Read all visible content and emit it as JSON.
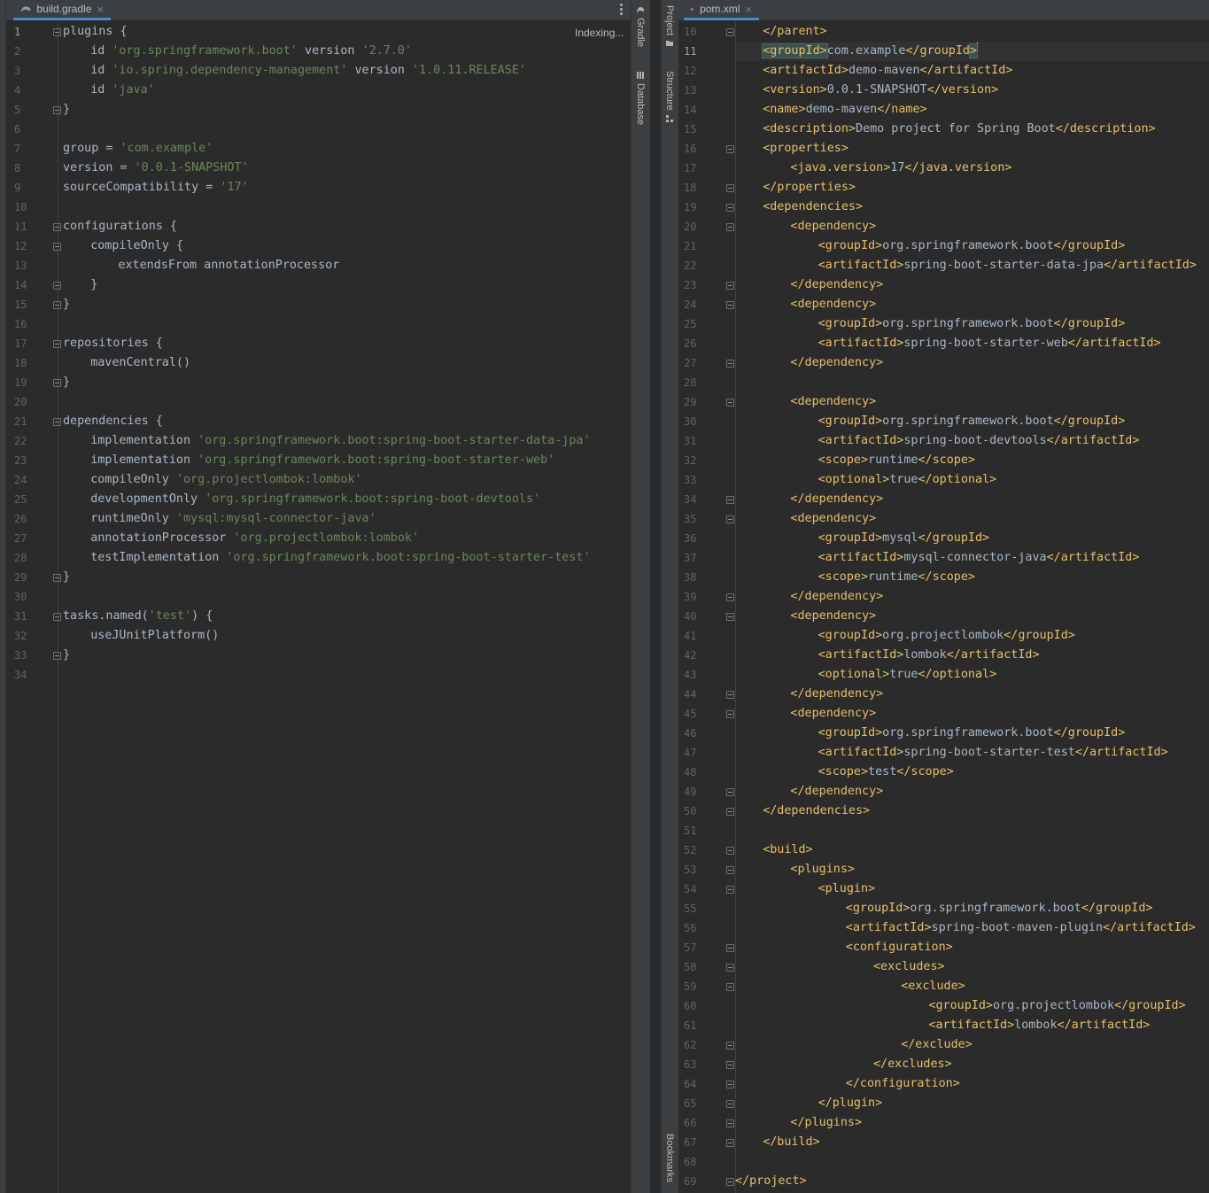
{
  "left_editor": {
    "tab": {
      "filename": "build.gradle",
      "icon": "gradle-elephant-icon"
    },
    "indexing_status": "Indexing...",
    "current_line": 1,
    "lines": [
      {
        "n": 1,
        "i": 0,
        "t": [
          {
            "k": "p",
            "v": "plugins {"
          }
        ],
        "fold": true
      },
      {
        "n": 2,
        "i": 1,
        "t": [
          {
            "k": "p",
            "v": "id "
          },
          {
            "k": "s",
            "v": "'org.springframework.boot'"
          },
          {
            "k": "p",
            "v": " version "
          },
          {
            "k": "s",
            "v": "'2.7.0'"
          }
        ]
      },
      {
        "n": 3,
        "i": 1,
        "t": [
          {
            "k": "p",
            "v": "id "
          },
          {
            "k": "s",
            "v": "'io.spring.dependency-management'"
          },
          {
            "k": "p",
            "v": " version "
          },
          {
            "k": "s",
            "v": "'1.0.11.RELEASE'"
          }
        ]
      },
      {
        "n": 4,
        "i": 1,
        "t": [
          {
            "k": "p",
            "v": "id "
          },
          {
            "k": "s",
            "v": "'java'"
          }
        ]
      },
      {
        "n": 5,
        "i": 0,
        "t": [
          {
            "k": "p",
            "v": "}"
          }
        ],
        "fold": true
      },
      {
        "n": 6,
        "i": 0,
        "t": []
      },
      {
        "n": 7,
        "i": 0,
        "t": [
          {
            "k": "p",
            "v": "group = "
          },
          {
            "k": "s",
            "v": "'com.example'"
          }
        ]
      },
      {
        "n": 8,
        "i": 0,
        "t": [
          {
            "k": "p",
            "v": "version = "
          },
          {
            "k": "s",
            "v": "'0.0.1-SNAPSHOT'"
          }
        ]
      },
      {
        "n": 9,
        "i": 0,
        "t": [
          {
            "k": "p",
            "v": "sourceCompatibility = "
          },
          {
            "k": "s",
            "v": "'17'"
          }
        ]
      },
      {
        "n": 10,
        "i": 0,
        "t": []
      },
      {
        "n": 11,
        "i": 0,
        "t": [
          {
            "k": "p",
            "v": "configurations {"
          }
        ],
        "fold": true
      },
      {
        "n": 12,
        "i": 1,
        "t": [
          {
            "k": "p",
            "v": "compileOnly {"
          }
        ],
        "fold": true
      },
      {
        "n": 13,
        "i": 2,
        "t": [
          {
            "k": "p",
            "v": "extendsFrom annotationProcessor"
          }
        ]
      },
      {
        "n": 14,
        "i": 1,
        "t": [
          {
            "k": "p",
            "v": "}"
          }
        ],
        "fold": true
      },
      {
        "n": 15,
        "i": 0,
        "t": [
          {
            "k": "p",
            "v": "}"
          }
        ],
        "fold": true
      },
      {
        "n": 16,
        "i": 0,
        "t": []
      },
      {
        "n": 17,
        "i": 0,
        "t": [
          {
            "k": "p",
            "v": "repositories {"
          }
        ],
        "fold": true
      },
      {
        "n": 18,
        "i": 1,
        "t": [
          {
            "k": "p",
            "v": "mavenCentral()"
          }
        ]
      },
      {
        "n": 19,
        "i": 0,
        "t": [
          {
            "k": "p",
            "v": "}"
          }
        ],
        "fold": true
      },
      {
        "n": 20,
        "i": 0,
        "t": []
      },
      {
        "n": 21,
        "i": 0,
        "t": [
          {
            "k": "p",
            "v": "dependencies {"
          }
        ],
        "fold": true
      },
      {
        "n": 22,
        "i": 1,
        "t": [
          {
            "k": "p",
            "v": "implementation "
          },
          {
            "k": "s",
            "v": "'org.springframework.boot:spring-boot-starter-data-jpa'"
          }
        ]
      },
      {
        "n": 23,
        "i": 1,
        "t": [
          {
            "k": "p",
            "v": "implementation "
          },
          {
            "k": "s",
            "v": "'org.springframework.boot:spring-boot-starter-web'"
          }
        ]
      },
      {
        "n": 24,
        "i": 1,
        "t": [
          {
            "k": "p",
            "v": "compileOnly "
          },
          {
            "k": "s",
            "v": "'org.projectlombok:lombok'"
          }
        ]
      },
      {
        "n": 25,
        "i": 1,
        "t": [
          {
            "k": "p",
            "v": "developmentOnly "
          },
          {
            "k": "s",
            "v": "'org.springframework.boot:spring-boot-devtools'"
          }
        ]
      },
      {
        "n": 26,
        "i": 1,
        "t": [
          {
            "k": "p",
            "v": "runtimeOnly "
          },
          {
            "k": "s",
            "v": "'mysql:mysql-connector-java'"
          }
        ]
      },
      {
        "n": 27,
        "i": 1,
        "t": [
          {
            "k": "p",
            "v": "annotationProcessor "
          },
          {
            "k": "s",
            "v": "'org.projectlombok:lombok'"
          }
        ]
      },
      {
        "n": 28,
        "i": 1,
        "t": [
          {
            "k": "p",
            "v": "testImplementation "
          },
          {
            "k": "s",
            "v": "'org.springframework.boot:spring-boot-starter-test'"
          }
        ]
      },
      {
        "n": 29,
        "i": 0,
        "t": [
          {
            "k": "p",
            "v": "}"
          }
        ],
        "fold": true
      },
      {
        "n": 30,
        "i": 0,
        "t": []
      },
      {
        "n": 31,
        "i": 0,
        "t": [
          {
            "k": "p",
            "v": "tasks.named("
          },
          {
            "k": "s",
            "v": "'test'"
          },
          {
            "k": "p",
            "v": ") {"
          }
        ],
        "fold": true
      },
      {
        "n": 32,
        "i": 1,
        "t": [
          {
            "k": "p",
            "v": "useJUnitPlatform()"
          }
        ]
      },
      {
        "n": 33,
        "i": 0,
        "t": [
          {
            "k": "p",
            "v": "}"
          }
        ],
        "fold": true
      },
      {
        "n": 34,
        "i": 0,
        "t": []
      }
    ]
  },
  "tool_windows": {
    "gradle": "Gradle",
    "database": "Database",
    "project": "Project",
    "structure": "Structure",
    "bookmarks": "Bookmarks"
  },
  "right_editor": {
    "tab": {
      "filename": "pom.xml",
      "icon": "maven-m-icon"
    },
    "current_line": 11,
    "lines": [
      {
        "n": 10,
        "i": 1,
        "t": "</parent>",
        "fold": true
      },
      {
        "n": 11,
        "i": 1,
        "t": "<groupId>com.example</groupId>",
        "caret": true
      },
      {
        "n": 12,
        "i": 1,
        "t": "<artifactId>demo-maven</artifactId>"
      },
      {
        "n": 13,
        "i": 1,
        "t": "<version>0.0.1-SNAPSHOT</version>"
      },
      {
        "n": 14,
        "i": 1,
        "t": "<name>demo-maven</name>"
      },
      {
        "n": 15,
        "i": 1,
        "t": "<description>Demo project for Spring Boot</description>"
      },
      {
        "n": 16,
        "i": 1,
        "t": "<properties>",
        "fold": true
      },
      {
        "n": 17,
        "i": 2,
        "t": "<java.version>17</java.version>"
      },
      {
        "n": 18,
        "i": 1,
        "t": "</properties>",
        "fold": true
      },
      {
        "n": 19,
        "i": 1,
        "t": "<dependencies>",
        "fold": true
      },
      {
        "n": 20,
        "i": 2,
        "t": "<dependency>",
        "fold": true
      },
      {
        "n": 21,
        "i": 3,
        "t": "<groupId>org.springframework.boot</groupId>"
      },
      {
        "n": 22,
        "i": 3,
        "t": "<artifactId>spring-boot-starter-data-jpa</artifactId>"
      },
      {
        "n": 23,
        "i": 2,
        "t": "</dependency>",
        "fold": true
      },
      {
        "n": 24,
        "i": 2,
        "t": "<dependency>",
        "fold": true
      },
      {
        "n": 25,
        "i": 3,
        "t": "<groupId>org.springframework.boot</groupId>"
      },
      {
        "n": 26,
        "i": 3,
        "t": "<artifactId>spring-boot-starter-web</artifactId>"
      },
      {
        "n": 27,
        "i": 2,
        "t": "</dependency>",
        "fold": true
      },
      {
        "n": 28,
        "i": 0,
        "t": ""
      },
      {
        "n": 29,
        "i": 2,
        "t": "<dependency>",
        "fold": true
      },
      {
        "n": 30,
        "i": 3,
        "t": "<groupId>org.springframework.boot</groupId>"
      },
      {
        "n": 31,
        "i": 3,
        "t": "<artifactId>spring-boot-devtools</artifactId>"
      },
      {
        "n": 32,
        "i": 3,
        "t": "<scope>runtime</scope>"
      },
      {
        "n": 33,
        "i": 3,
        "t": "<optional>true</optional>"
      },
      {
        "n": 34,
        "i": 2,
        "t": "</dependency>",
        "fold": true
      },
      {
        "n": 35,
        "i": 2,
        "t": "<dependency>",
        "fold": true
      },
      {
        "n": 36,
        "i": 3,
        "t": "<groupId>mysql</groupId>"
      },
      {
        "n": 37,
        "i": 3,
        "t": "<artifactId>mysql-connector-java</artifactId>"
      },
      {
        "n": 38,
        "i": 3,
        "t": "<scope>runtime</scope>"
      },
      {
        "n": 39,
        "i": 2,
        "t": "</dependency>",
        "fold": true
      },
      {
        "n": 40,
        "i": 2,
        "t": "<dependency>",
        "fold": true
      },
      {
        "n": 41,
        "i": 3,
        "t": "<groupId>org.projectlombok</groupId>"
      },
      {
        "n": 42,
        "i": 3,
        "t": "<artifactId>lombok</artifactId>"
      },
      {
        "n": 43,
        "i": 3,
        "t": "<optional>true</optional>"
      },
      {
        "n": 44,
        "i": 2,
        "t": "</dependency>",
        "fold": true
      },
      {
        "n": 45,
        "i": 2,
        "t": "<dependency>",
        "fold": true
      },
      {
        "n": 46,
        "i": 3,
        "t": "<groupId>org.springframework.boot</groupId>"
      },
      {
        "n": 47,
        "i": 3,
        "t": "<artifactId>spring-boot-starter-test</artifactId>"
      },
      {
        "n": 48,
        "i": 3,
        "t": "<scope>test</scope>"
      },
      {
        "n": 49,
        "i": 2,
        "t": "</dependency>",
        "fold": true
      },
      {
        "n": 50,
        "i": 1,
        "t": "</dependencies>",
        "fold": true
      },
      {
        "n": 51,
        "i": 0,
        "t": ""
      },
      {
        "n": 52,
        "i": 1,
        "t": "<build>",
        "fold": true
      },
      {
        "n": 53,
        "i": 2,
        "t": "<plugins>",
        "fold": true
      },
      {
        "n": 54,
        "i": 3,
        "t": "<plugin>",
        "fold": true
      },
      {
        "n": 55,
        "i": 4,
        "t": "<groupId>org.springframework.boot</groupId>"
      },
      {
        "n": 56,
        "i": 4,
        "t": "<artifactId>spring-boot-maven-plugin</artifactId>"
      },
      {
        "n": 57,
        "i": 4,
        "t": "<configuration>",
        "fold": true
      },
      {
        "n": 58,
        "i": 5,
        "t": "<excludes>",
        "fold": true
      },
      {
        "n": 59,
        "i": 6,
        "t": "<exclude>",
        "fold": true
      },
      {
        "n": 60,
        "i": 7,
        "t": "<groupId>org.projectlombok</groupId>"
      },
      {
        "n": 61,
        "i": 7,
        "t": "<artifactId>lombok</artifactId>"
      },
      {
        "n": 62,
        "i": 6,
        "t": "</exclude>",
        "fold": true
      },
      {
        "n": 63,
        "i": 5,
        "t": "</excludes>",
        "fold": true
      },
      {
        "n": 64,
        "i": 4,
        "t": "</configuration>",
        "fold": true
      },
      {
        "n": 65,
        "i": 3,
        "t": "</plugin>",
        "fold": true
      },
      {
        "n": 66,
        "i": 2,
        "t": "</plugins>",
        "fold": true
      },
      {
        "n": 67,
        "i": 1,
        "t": "</build>",
        "fold": true
      },
      {
        "n": 68,
        "i": 0,
        "t": ""
      },
      {
        "n": 69,
        "i": 0,
        "t": "</project>",
        "fold": true
      }
    ]
  },
  "colors": {
    "background": "#2b2b2b",
    "plain": "#a9b7c6",
    "string": "#6a8759",
    "xml_tag": "#e8bf6a",
    "line_number": "#606366",
    "tab_underline": "#4a88c7"
  }
}
